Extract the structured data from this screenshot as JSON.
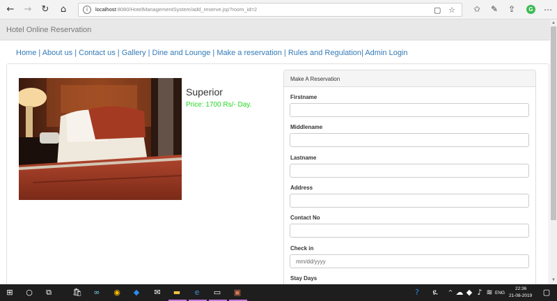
{
  "browser": {
    "url_host": "localhost",
    "url_path": ":8080/HotelManagementSystem/add_reserve.jsp?room_id=2",
    "icons": [
      "back-icon",
      "forward-icon",
      "refresh-icon",
      "home-icon",
      "info-icon",
      "reading-view-icon",
      "favorite-star-icon",
      "favorites-icon",
      "pen-icon",
      "share-icon",
      "profile-icon"
    ],
    "profile_letter": "G"
  },
  "site": {
    "brand": "Hotel Online Reservation",
    "nav": [
      {
        "label": "Home"
      },
      {
        "label": "About us"
      },
      {
        "label": "Contact us"
      },
      {
        "label": "Gallery"
      },
      {
        "label": "Dine and Lounge"
      },
      {
        "label": "Make a reservation"
      },
      {
        "label": "Rules and Regulation"
      },
      {
        "label": "Admin Login"
      }
    ]
  },
  "room": {
    "name": "Superior",
    "price": "Price: 1700 Rs/- Day."
  },
  "form": {
    "heading": "Make A Reservation",
    "fields": [
      {
        "label": "Firstname",
        "value": "",
        "placeholder": ""
      },
      {
        "label": "Middlename",
        "value": "",
        "placeholder": ""
      },
      {
        "label": "Lastname",
        "value": "",
        "placeholder": ""
      },
      {
        "label": "Address",
        "value": "",
        "placeholder": ""
      },
      {
        "label": "Contact No",
        "value": "",
        "placeholder": ""
      },
      {
        "label": "Check in",
        "value": "",
        "placeholder": "mm/dd/yyyy"
      },
      {
        "label": "Stay Days",
        "value": "",
        "placeholder": ""
      }
    ]
  },
  "taskbar": {
    "language": "ENG",
    "time": "22:36",
    "date": "21-08-2019",
    "accent_color": "#c678dd"
  },
  "colors": {
    "link": "#337ab7",
    "price": "#21d921",
    "header_bg": "#e8e8e8"
  }
}
